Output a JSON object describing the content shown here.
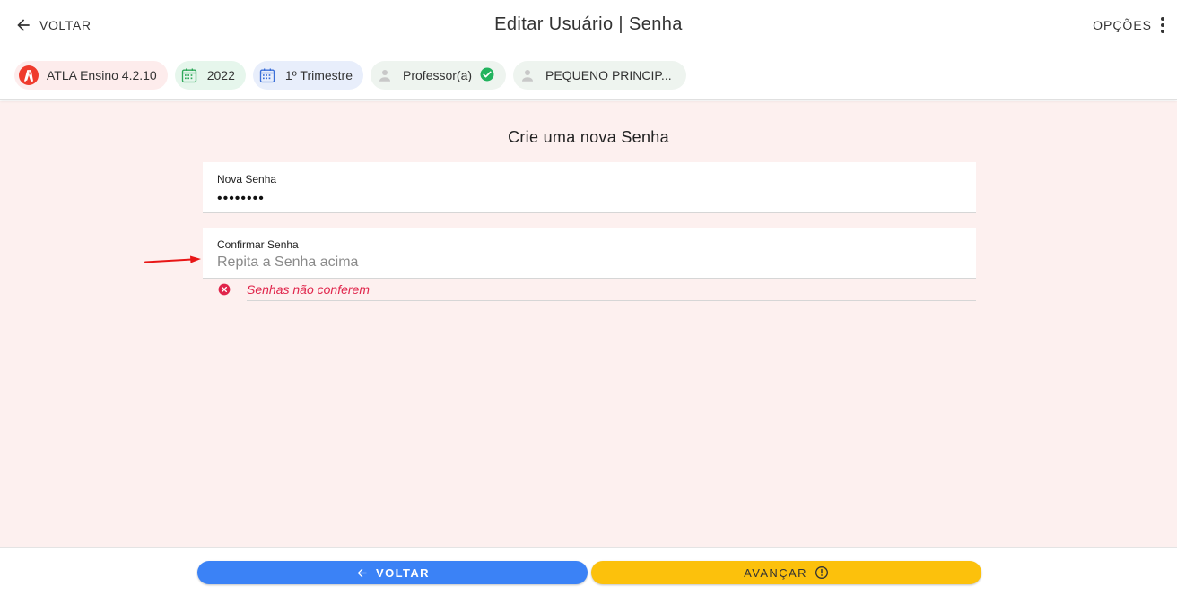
{
  "header": {
    "back_label": "VOLTAR",
    "title": "Editar Usuário | Senha",
    "options_label": "OPÇÕES"
  },
  "chips": {
    "app": "ATLA Ensino 4.2.10",
    "year": "2022",
    "term": "1º Trimestre",
    "role": "Professor(a)",
    "school": "PEQUENO PRINCIP..."
  },
  "form": {
    "section_title": "Crie uma nova Senha",
    "new_password": {
      "label": "Nova Senha",
      "value": "••••••••"
    },
    "confirm_password": {
      "label": "Confirmar Senha",
      "placeholder": "Repita a Senha acima",
      "value": ""
    },
    "error_message": "Senhas não conferem"
  },
  "footer": {
    "back_label": "VOLTAR",
    "next_label": "AVANÇAR"
  },
  "colors": {
    "accent_blue": "#3b82f6",
    "accent_yellow": "#fcc10c",
    "error_red": "#e0254b",
    "success_green": "#22b35e",
    "page_background": "#fdf0ef"
  },
  "icons": {
    "back": "arrow-left-icon",
    "options": "more-vert-icon",
    "app": "atla-logo-icon",
    "calendar": "calendar-icon",
    "user": "person-icon",
    "check": "check-circle-icon",
    "error": "error-circle-icon",
    "alert": "alert-circle-icon",
    "annotation": "red-arrow-annotation"
  }
}
